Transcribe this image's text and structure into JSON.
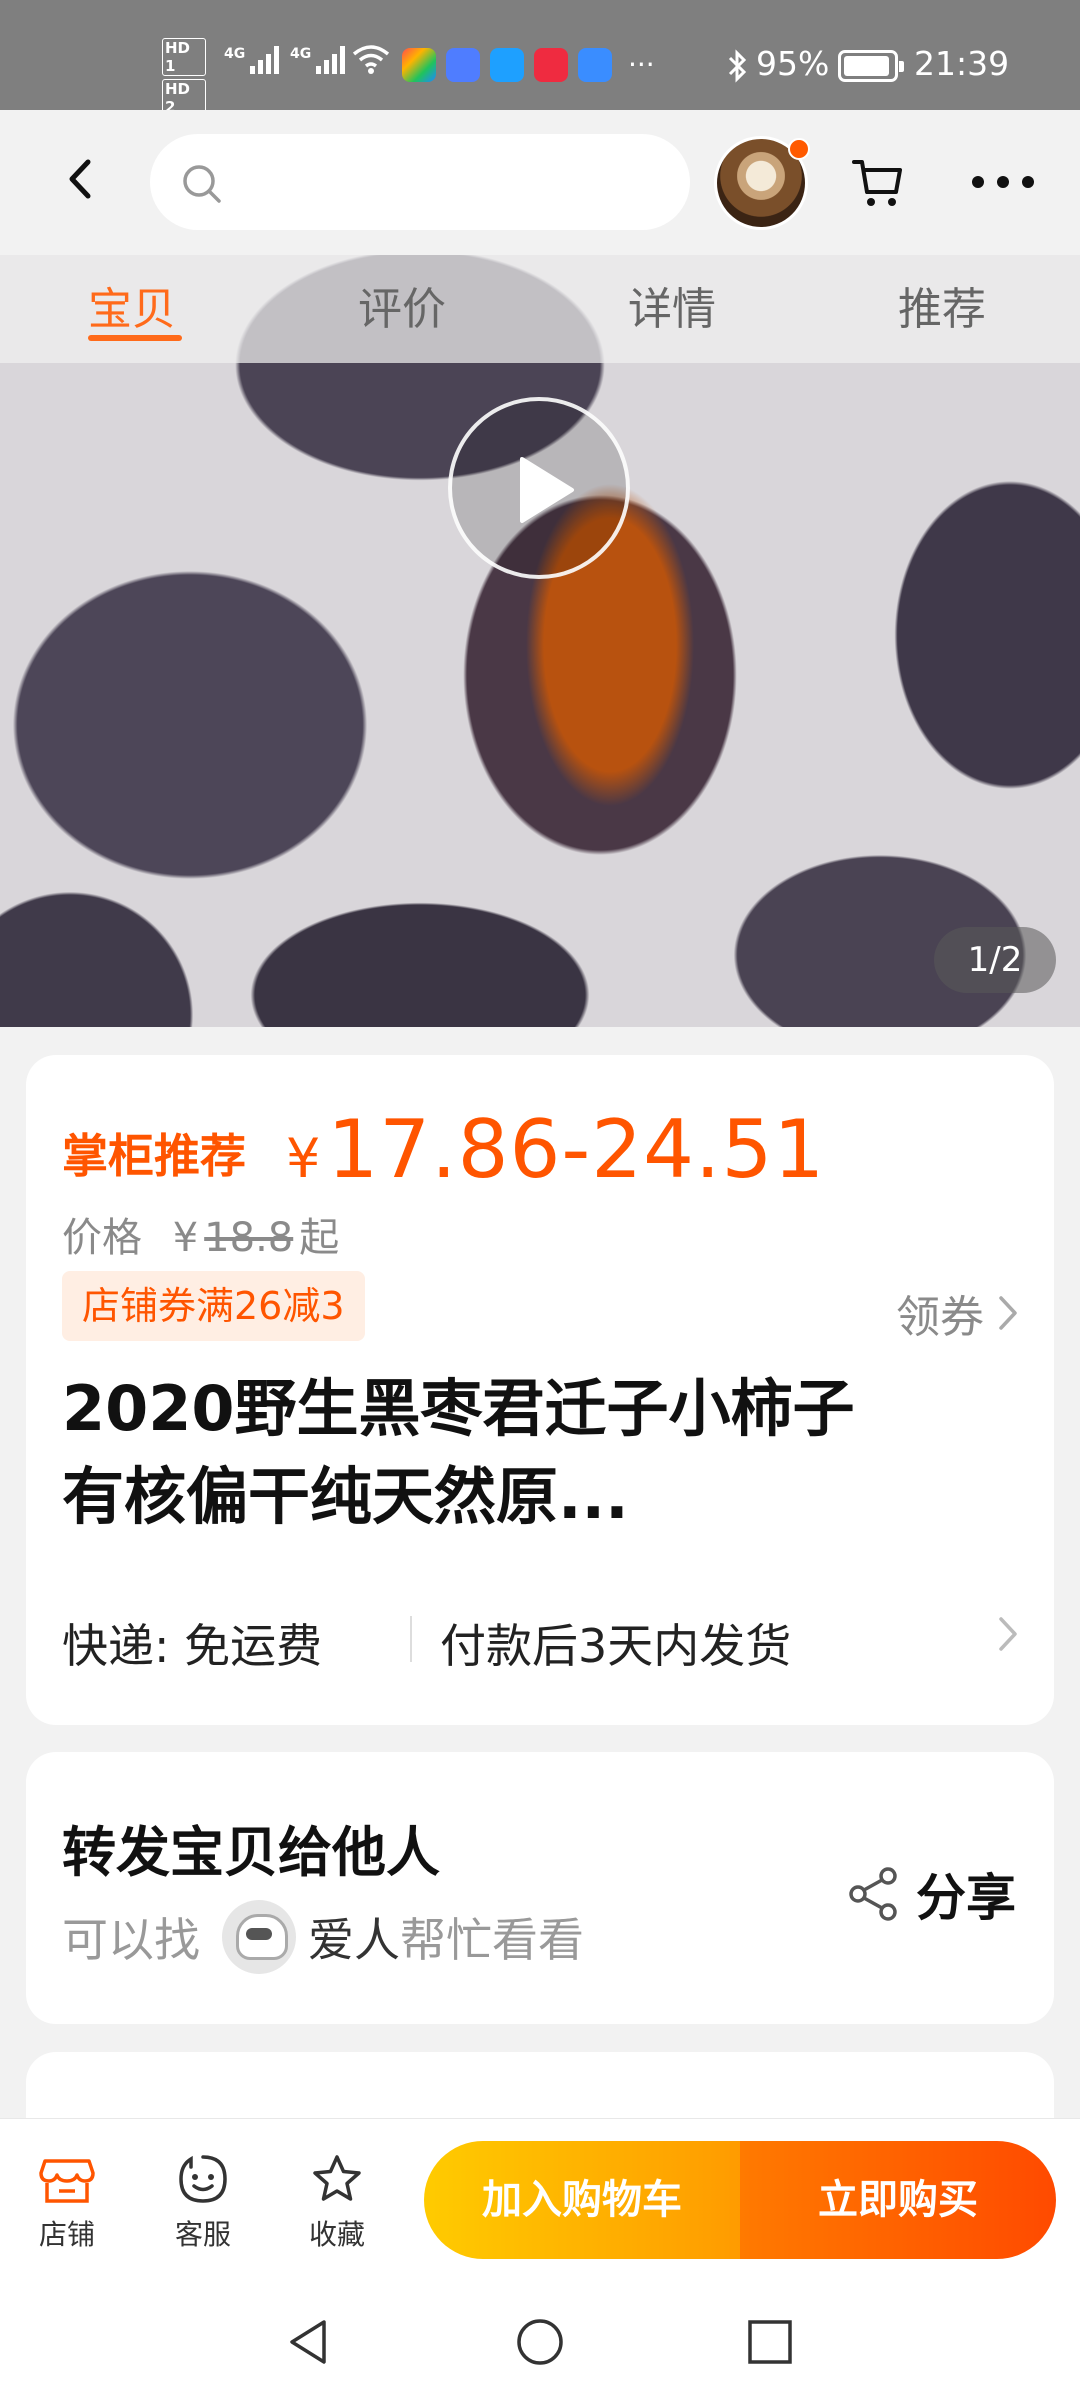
{
  "status_bar": {
    "hd1": "HD 1",
    "hd2": "HD 2",
    "net1": "4G",
    "net2": "4G",
    "app_icons": [
      "tape-app-icon",
      "music-app-icon",
      "search-app-icon",
      "huawei-app-icon",
      "cloud-app-icon"
    ],
    "more": "···",
    "battery_pct": "95%",
    "battery_level": 0.95,
    "time": "21:39"
  },
  "top_nav": {
    "search_placeholder": "",
    "has_notification_dot": true
  },
  "hero": {
    "tabs": [
      "宝贝",
      "评价",
      "详情",
      "推荐"
    ],
    "active_tab": 0,
    "page_counter": "1/2"
  },
  "price_card": {
    "promo_label": "掌柜推荐",
    "currency": "¥",
    "price_range": "17.86-24.51",
    "orig_prefix": "价格",
    "orig_currency": "¥",
    "orig_price": "18.8",
    "orig_suffix": "起",
    "coupon_badge": "店铺券满26减3",
    "coupon_link": "领券",
    "title": "2020野生黑枣君迁子小柿子有核偏干纯天然原...",
    "shipping_method": "快递: 免运费",
    "shipping_time": "付款后3天内发货"
  },
  "share_card": {
    "title": "转发宝贝给他人",
    "sub_prefix": "可以找",
    "sub_who": "爱人",
    "sub_suffix": "帮忙看看",
    "share_label": "分享"
  },
  "action_bar": {
    "store": "店铺",
    "service": "客服",
    "favorite": "收藏",
    "add_to_cart": "加入购物车",
    "buy_now": "立即购买"
  },
  "colors": {
    "accent": "#ff5500",
    "cart_gradient": [
      "#ffcb00",
      "#ff9b00"
    ],
    "buy_gradient": [
      "#ff7a00",
      "#ff4a00"
    ]
  }
}
